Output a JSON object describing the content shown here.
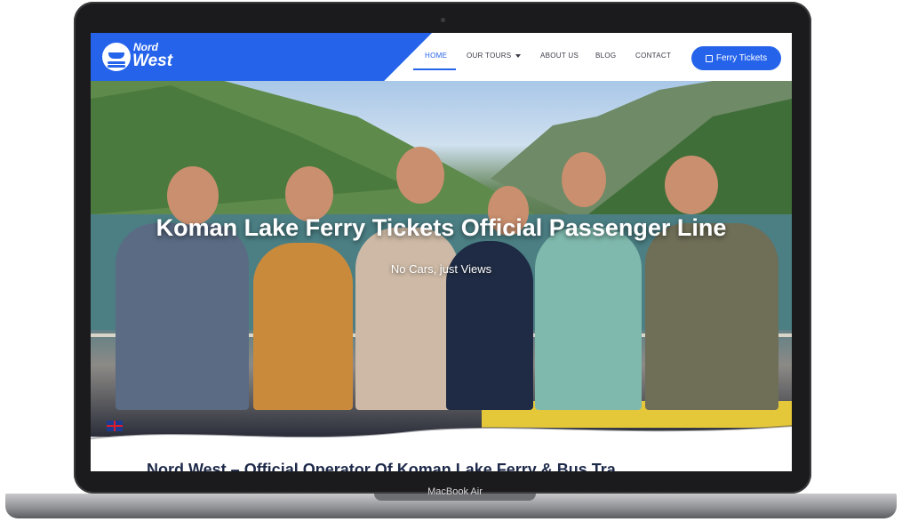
{
  "device": {
    "label": "MacBook Air"
  },
  "header": {
    "logo": {
      "line1": "Nord",
      "line2": "West"
    },
    "nav": [
      {
        "label": "HOME",
        "active": true
      },
      {
        "label": "OUR TOURS",
        "has_dropdown": true
      },
      {
        "label": "ABOUT US"
      },
      {
        "label": "BLOG"
      },
      {
        "label": "CONTACT"
      }
    ],
    "cta": {
      "label": "Ferry Tickets",
      "icon": "calendar-icon"
    }
  },
  "hero": {
    "title": "Koman Lake Ferry Tickets Official Passenger Line",
    "subtitle": "No Cars, just Views"
  },
  "language": {
    "icon": "uk-flag-icon"
  },
  "section": {
    "title": "Nord West – Official Operator Of Koman Lake Ferry & Bus Tra"
  },
  "colors": {
    "brand": "#2563eb",
    "heading": "#1e2a4a"
  }
}
